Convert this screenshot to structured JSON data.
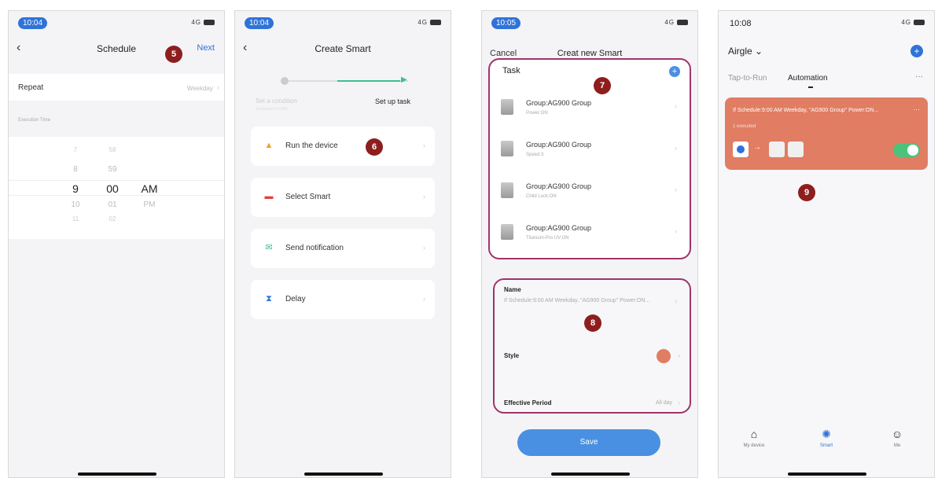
{
  "phone1": {
    "time": "10:04",
    "signal": "4G",
    "title": "Schedule",
    "next": "Next",
    "step": "5",
    "repeat_label": "Repeat",
    "repeat_value": "Weekday",
    "section": "Execution Time",
    "hours": [
      "7",
      "8",
      "9",
      "10",
      "11"
    ],
    "minutes": [
      "58",
      "59",
      "00",
      "01",
      "02"
    ],
    "ampm": [
      "AM",
      "PM"
    ]
  },
  "phone2": {
    "time": "10:04",
    "signal": "4G",
    "title": "Create Smart",
    "step": "6",
    "step1": "Set a condition",
    "step1_sub": "Schedule:9:00 AM",
    "step2": "Set up task",
    "items": [
      {
        "label": "Run the device",
        "icon": "bulb-icon"
      },
      {
        "label": "Select Smart",
        "icon": "smart-icon"
      },
      {
        "label": "Send notification",
        "icon": "notification-icon"
      },
      {
        "label": "Delay",
        "icon": "hourglass-icon"
      }
    ]
  },
  "phone3": {
    "time": "10:05",
    "signal": "4G",
    "cancel": "Cancel",
    "title": "Creat new Smart",
    "task_header": "Task",
    "step7": "7",
    "step8": "8",
    "tasks": [
      {
        "name": "Group:AG900 Group",
        "detail": "Power:ON"
      },
      {
        "name": "Group:AG900 Group",
        "detail": "Speed:3"
      },
      {
        "name": "Group:AG900 Group",
        "detail": "Child Lock:ON"
      },
      {
        "name": "Group:AG900 Group",
        "detail": "Titanium-Pro UV:ON"
      }
    ],
    "name_label": "Name",
    "name_value": "If Schedule:9:00 AM Weekday, \"AG900 Group\" Power:ON...",
    "style_label": "Style",
    "style_color": "#e07d63",
    "period_label": "Effective Period",
    "period_value": "All day",
    "save": "Save"
  },
  "phone4": {
    "time": "10:08",
    "signal": "4G",
    "home": "Airgle",
    "tab_run": "Tap-to-Run",
    "tab_auto": "Automation",
    "more": "···",
    "step9": "9",
    "card_text": "If Schedule:9:00 AM Weekday, \"AG900 Group\" Power:ON...",
    "card_sub": "1 executed",
    "card_color": "#e07d63",
    "tabs": [
      "My device",
      "Smart",
      "Me"
    ]
  }
}
